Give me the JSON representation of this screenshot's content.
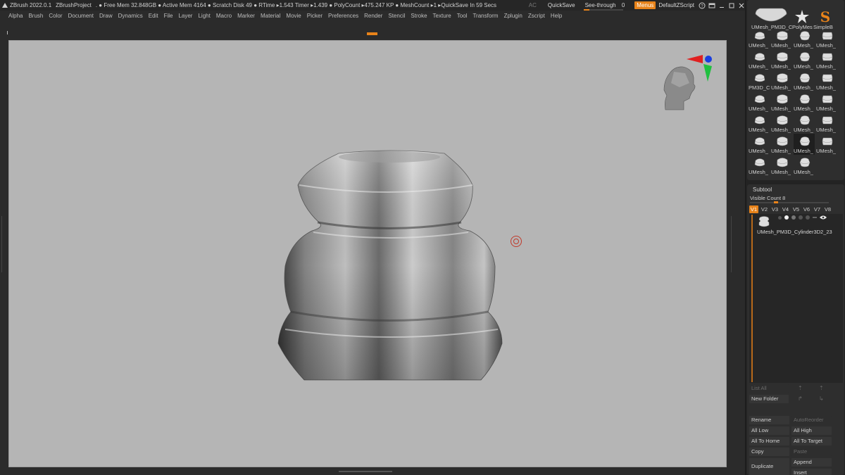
{
  "titlebar": {
    "app": "ZBrush 2022.0.1",
    "project": "ZBrushProject",
    "status": ". ● Free Mem 32.848GB ● Active Mem 4164 ● Scratch Disk 49 ● RTime ▸1.543 Timer ▸1.439 ● PolyCount ▸475.247 KP ● MeshCount ▸1 ▸QuickSave In 59 Secs",
    "ac": "AC",
    "quicksave": "QuickSave",
    "seethrough": "See-through",
    "seethrough_value": "0",
    "menus": "Menus",
    "default_zscript": "DefaultZScript",
    "accent": "#e8831a"
  },
  "menubar": [
    "Alpha",
    "Brush",
    "Color",
    "Document",
    "Draw",
    "Dynamics",
    "Edit",
    "File",
    "Layer",
    "Light",
    "Macro",
    "Marker",
    "Material",
    "Movie",
    "Picker",
    "Preferences",
    "Render",
    "Stencil",
    "Stroke",
    "Texture",
    "Tool",
    "Transform",
    "Zplugin",
    "Zscript",
    "Help"
  ],
  "canvas": {
    "background": "#b5b5b5",
    "model": "cylinder-vase-mesh",
    "gizmo": "head-orientation-gizmo"
  },
  "tool_palette": {
    "top_row": [
      "UMesh_PM3D_C",
      "PolyMes",
      "SimpleB"
    ],
    "grid": [
      "UMesh_",
      "UMesh_",
      "UMesh_",
      "UMesh_",
      "UMesh_",
      "UMesh_",
      "UMesh_",
      "UMesh_",
      "PM3D_C",
      "UMesh_",
      "UMesh_",
      "UMesh_",
      "UMesh_",
      "UMesh_",
      "UMesh_",
      "UMesh_",
      "UMesh_",
      "UMesh_",
      "UMesh_",
      "UMesh_",
      "UMesh_",
      "UMesh_",
      "UMesh_",
      "UMesh_",
      "UMesh_",
      "UMesh_",
      "UMesh_"
    ]
  },
  "subtool": {
    "title": "Subtool",
    "visible_count": "Visible Count 8",
    "tabs": [
      "V1",
      "V2",
      "V3",
      "V4",
      "V5",
      "V6",
      "V7",
      "V8"
    ],
    "item_name": "UMesh_PM3D_Cylinder3D2_23",
    "buttons": {
      "list_all": "List All",
      "new_folder": "New Folder",
      "rename": "Rename",
      "auto_reorder": "AutoReorder",
      "all_low": "All Low",
      "all_high": "All High",
      "all_to_home": "All To Home",
      "all_to_target": "All To Target",
      "copy": "Copy",
      "paste": "Paste",
      "duplicate": "Duplicate",
      "append": "Append",
      "insert": "Insert"
    }
  }
}
